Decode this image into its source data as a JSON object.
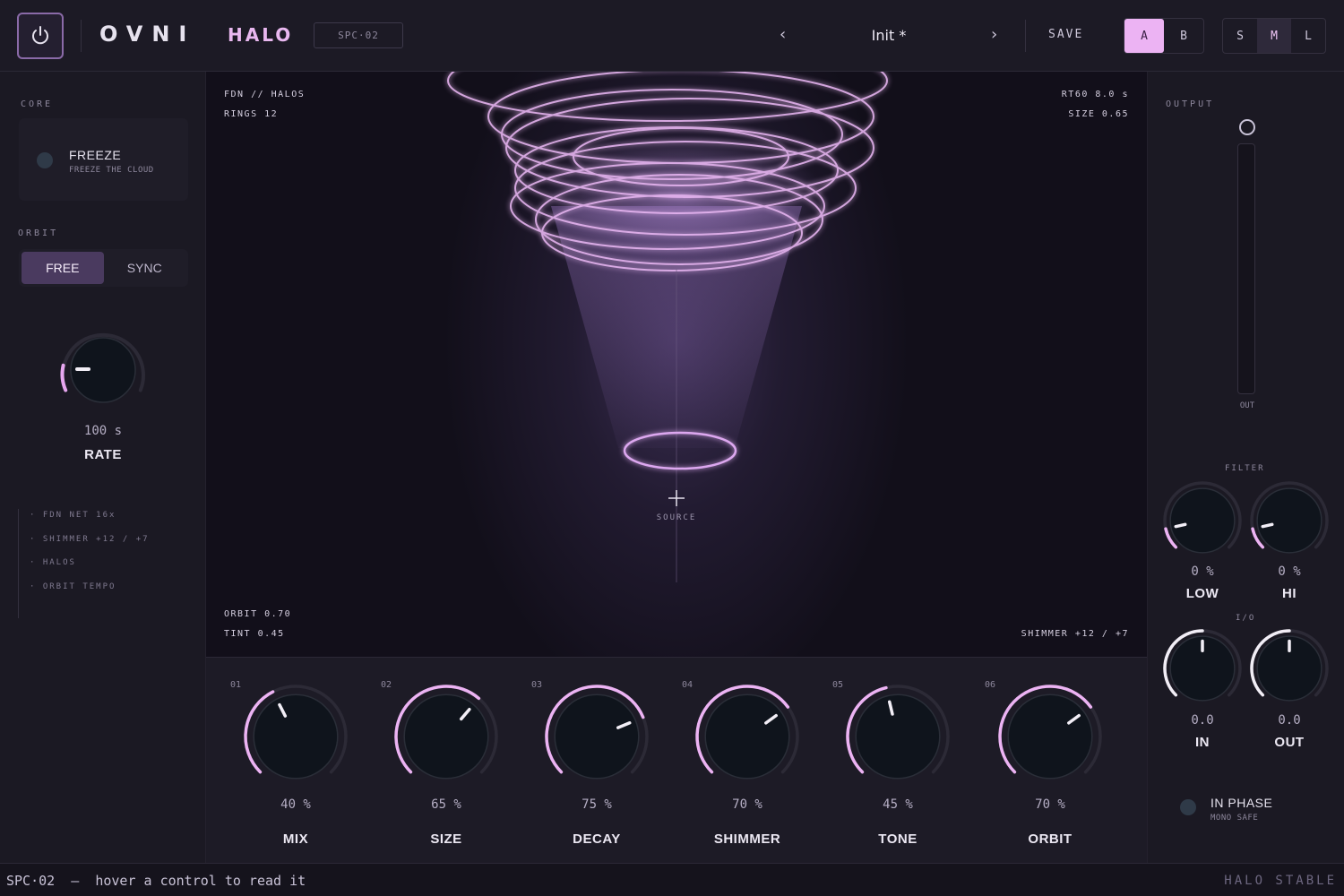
{
  "header": {
    "brand": "OVNI",
    "product": "HALO",
    "model": "SPC·02",
    "preset_prev": "‹",
    "preset_name": "Init *",
    "preset_next": "›",
    "save_label": "SAVE",
    "ab": [
      "A",
      "B"
    ],
    "ab_selected": "A",
    "sizes": [
      "S",
      "M",
      "L"
    ],
    "size_selected": "M",
    "accent": "#ecb3f3"
  },
  "left": {
    "core_label": "CORE",
    "freeze_title": "FREEZE",
    "freeze_sub": "FREEZE THE CLOUD",
    "orbit_label": "ORBIT",
    "orbit_modes": [
      "FREE",
      "SYNC"
    ],
    "orbit_mode_selected": "FREE",
    "rate_value": "100 s",
    "rate_label": "RATE",
    "features": [
      "· FDN NET 16x",
      "· SHIMMER +12 / +7",
      "· HALOS",
      "· ORBIT TEMPO"
    ]
  },
  "visual": {
    "tl1": "FDN // HALOS",
    "tl2": "RINGS 12",
    "tr1": "RT60 8.0 s",
    "tr2": "SIZE 0.65",
    "bl1": "ORBIT 0.70",
    "bl2": "TINT 0.45",
    "br1": "SHIMMER +12 / +7",
    "source": "SOURCE"
  },
  "knobs": [
    {
      "index": "01",
      "value": "40 %",
      "label": "MIX",
      "level": 0.4
    },
    {
      "index": "02",
      "value": "65 %",
      "label": "SIZE",
      "level": 0.65
    },
    {
      "index": "03",
      "value": "75 %",
      "label": "DECAY",
      "level": 0.75
    },
    {
      "index": "04",
      "value": "70 %",
      "label": "SHIMMER",
      "level": 0.7
    },
    {
      "index": "05",
      "value": "45 %",
      "label": "TONE",
      "level": 0.45
    },
    {
      "index": "06",
      "value": "70 %",
      "label": "ORBIT",
      "level": 0.7
    }
  ],
  "right": {
    "output_label": "OUTPUT",
    "out_meter_label": "OUT",
    "filter_label": "FILTER",
    "low_value": "0 %",
    "low_label": "LOW",
    "hi_value": "0 %",
    "hi_label": "HI",
    "io_label": "I/O",
    "in_value": "0.0",
    "in_label": "IN",
    "out_value": "0.0",
    "out_label": "OUT",
    "inphase_title": "IN PHASE",
    "inphase_sub": "MONO SAFE"
  },
  "status": {
    "left": "SPC·02  —  hover a control to read it",
    "right": "HALO STABLE"
  }
}
